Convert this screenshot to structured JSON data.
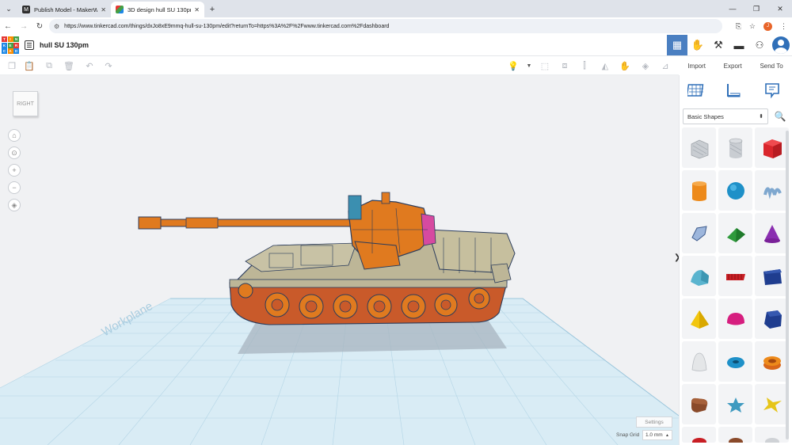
{
  "browser": {
    "tabs": [
      {
        "title": "Publish Model - MakerWorld",
        "favicon": "M",
        "active": false
      },
      {
        "title": "3D design hull SU 130pm - Tink",
        "favicon": "T",
        "active": true
      }
    ],
    "url": "https://www.tinkercad.com/things/dxJo8xE9mmq-hull-su-130pm/edit?returnTo=https%3A%2F%2Fwww.tinkercad.com%2Fdashboard",
    "profile_initial": "J"
  },
  "app": {
    "logo_letters": [
      "T",
      "I",
      "N",
      "K",
      "E",
      "R",
      "C",
      "A",
      "D"
    ],
    "design_title": "hull SU 130pm",
    "header_actions": {
      "import": "Import",
      "export": "Export",
      "send_to": "Send To"
    }
  },
  "workspace": {
    "viewcube_face": "RIGHT",
    "workplane_label": "Workplane",
    "settings_label": "Settings",
    "snap_grid_label": "Snap Grid",
    "snap_grid_value": "1.0 mm"
  },
  "panel": {
    "category": "Basic Shapes",
    "shapes": [
      {
        "name": "Box Hole",
        "icon": "box-hole-icon"
      },
      {
        "name": "Cylinder Hole",
        "icon": "cylinder-hole-icon"
      },
      {
        "name": "Box",
        "icon": "box-icon"
      },
      {
        "name": "Cylinder",
        "icon": "cylinder-icon"
      },
      {
        "name": "Sphere",
        "icon": "sphere-icon"
      },
      {
        "name": "Scribble",
        "icon": "scribble-icon"
      },
      {
        "name": "Polygon",
        "icon": "polygon-icon"
      },
      {
        "name": "Roof",
        "icon": "roof-icon"
      },
      {
        "name": "Cone",
        "icon": "cone-icon"
      },
      {
        "name": "Round Roof",
        "icon": "round-roof-icon"
      },
      {
        "name": "Text",
        "icon": "text-icon"
      },
      {
        "name": "Wedge",
        "icon": "wedge-icon"
      },
      {
        "name": "Pyramid",
        "icon": "pyramid-icon"
      },
      {
        "name": "Half Sphere",
        "icon": "half-sphere-icon"
      },
      {
        "name": "Polygon Prism",
        "icon": "polygon-prism-icon"
      },
      {
        "name": "Paraboloid",
        "icon": "paraboloid-icon"
      },
      {
        "name": "Torus",
        "icon": "torus-icon"
      },
      {
        "name": "Tube",
        "icon": "tube-icon"
      },
      {
        "name": "Heart",
        "icon": "heart-icon"
      },
      {
        "name": "Star",
        "icon": "star-icon"
      },
      {
        "name": "Icosahedron Star",
        "icon": "icosahedron-star-icon"
      }
    ]
  },
  "colors": {
    "accent": "#4a7fc1",
    "model_orange": "#e07a1f",
    "model_olive": "#bdb697",
    "model_pink": "#d64aa0",
    "model_teal": "#3b8fb0",
    "grid_blue": "#cfe4ef"
  }
}
